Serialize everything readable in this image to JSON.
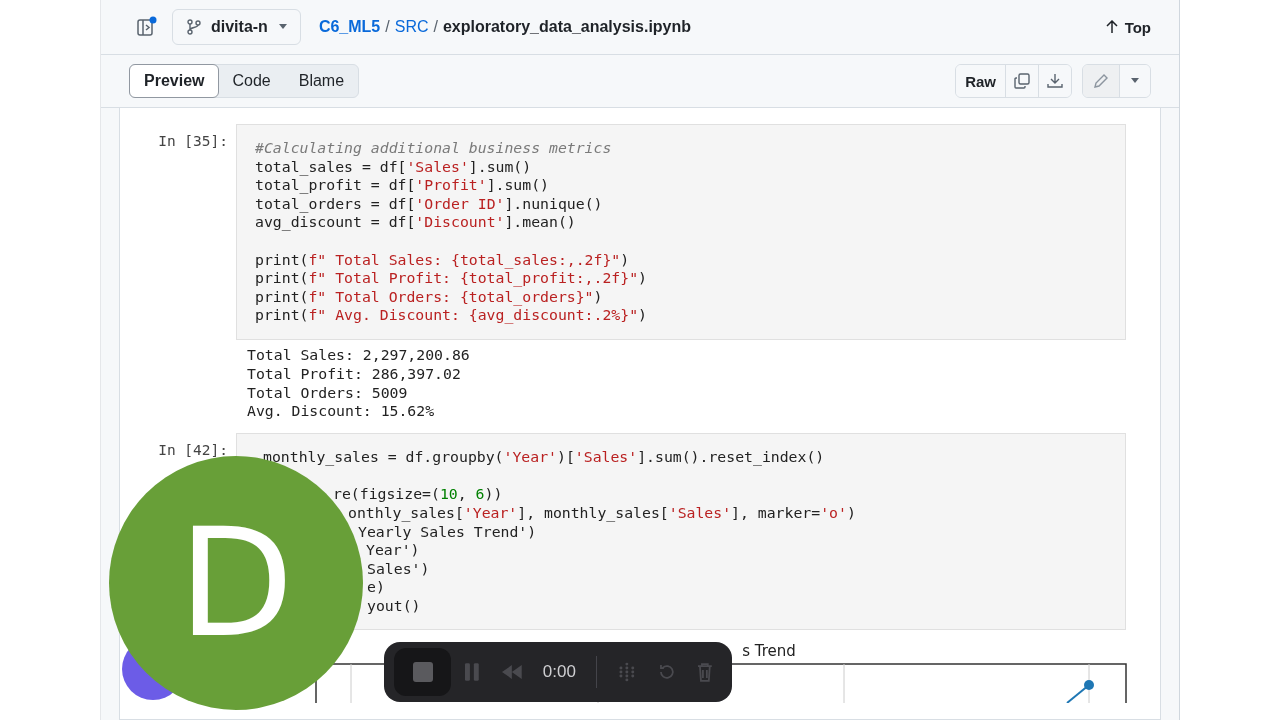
{
  "header": {
    "branch": "divita-n",
    "breadcrumb_links": [
      "C6_ML5",
      "SRC"
    ],
    "separator": "/",
    "file": "exploratory_data_analysis.ipynb",
    "top": "Top"
  },
  "tabs": [
    {
      "label": "Preview",
      "selected": true
    },
    {
      "label": "Code",
      "selected": false
    },
    {
      "label": "Blame",
      "selected": false
    }
  ],
  "file_actions": {
    "raw": "Raw"
  },
  "cells": [
    {
      "prompt": "In [35]:",
      "code": [
        [
          "#Calculating additional business metrics",
          "total_sales = df['Sales'].sum()",
          "total_profit = df['Profit'].sum()",
          "total_orders = df['Order ID'].nunique()",
          "avg_discount = df['Discount'].mean()"
        ],
        [
          "print(f\" Total Sales: {total_sales:,.2f}\")",
          "print(f\" Total Profit: {total_profit:,.2f}\")",
          "print(f\" Total Orders: {total_orders}\")",
          "print(f\" Avg. Discount: {avg_discount:.2%}\")"
        ]
      ],
      "output": [
        "Total Sales: 2,297,200.86",
        "Total Profit: 286,397.02",
        "Total Orders: 5009",
        "Avg. Discount: 15.62%"
      ]
    },
    {
      "prompt": "In [42]:",
      "code": [
        [
          "monthly_sales = df.groupby('Year')['Sales'].sum().reset_index()"
        ],
        [
          "re(figsize=(10, 6))",
          "onthly_sales['Year'], monthly_sales['Sales'], marker='o')",
          "Yearly Sales Trend')",
          "Year')",
          "Sales')",
          "e)",
          "yout()"
        ]
      ],
      "chart_title": "s Trend"
    }
  ],
  "avatar": {
    "letter": "D"
  },
  "recorder": {
    "time": "0:00"
  }
}
